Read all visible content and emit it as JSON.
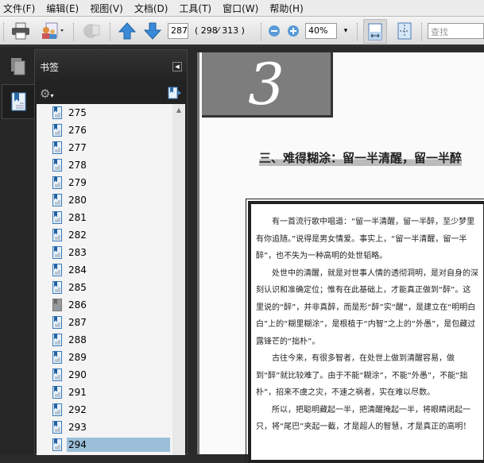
{
  "menu": [
    "文件(F)",
    "编辑(E)",
    "视图(V)",
    "文档(D)",
    "工具(T)",
    "窗口(W)",
    "帮助(H)"
  ],
  "toolbar": {
    "page_input": "287",
    "page_count": "( 298⁄ 313 )",
    "zoom": "40%",
    "search_placeholder": "查找"
  },
  "panel": {
    "title": "书签",
    "items": [
      "275",
      "276",
      "277",
      "278",
      "279",
      "280",
      "281",
      "282",
      "283",
      "284",
      "285",
      "286",
      "287",
      "288",
      "289",
      "290",
      "291",
      "292",
      "293",
      "294"
    ],
    "selected": "294"
  },
  "document": {
    "chapter_number": "3",
    "title": "三、难得糊涂：留一半清醒，留一半醉",
    "paragraphs": [
      "有一首流行歌中唱道：“留一半清醒，留一半醉，至少梦里有你追随。”说得是男女情爱。事实上，“留一半清醒，留一半醉”，也不失为一种高明的处世韬略。",
      "处世中的清醒，就是对世事人情的透彻洞明，是对自身的深刻认识和准确定位；惟有在此基础上，才能真正做到“醉”。这里说的“醉”，并非真醉，而是形“醉”实“醒”，是建立在“明明白白”上的“糊里糊涂”，是根植于“内智”之上的“外愚”，是包藏过露锋芒的“拙朴”。",
      "古往今来，有很多智者，在处世上做到清醒容易，做到“醉”就比较难了。由于不能“糊涂”，不能“外愚”，不能“拙朴”，招来不虞之灾，不速之祸者，实在难以尽数。",
      "所以，把聪明藏起一半，把清醒掩起一半，将眼睛闭起一只，将“尾巴”夹起一截，才是超人的智慧，才是真正的高明！"
    ]
  }
}
